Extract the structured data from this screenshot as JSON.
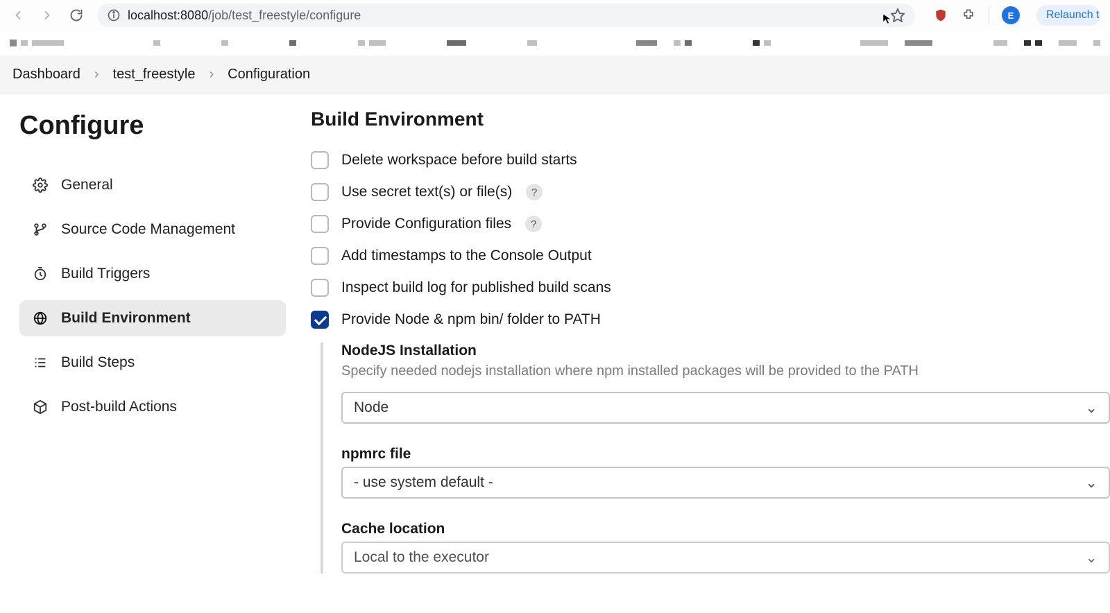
{
  "browser": {
    "url_host": "localhost:8080",
    "url_path": "/job/test_freestyle/configure",
    "avatar_initial": "E",
    "relaunch_label": "Relaunch t"
  },
  "breadcrumb": {
    "items": [
      "Dashboard",
      "test_freestyle",
      "Configuration"
    ]
  },
  "sidebar": {
    "title": "Configure",
    "items": [
      {
        "id": "general",
        "label": "General"
      },
      {
        "id": "scm",
        "label": "Source Code Management"
      },
      {
        "id": "triggers",
        "label": "Build Triggers"
      },
      {
        "id": "env",
        "label": "Build Environment",
        "active": true
      },
      {
        "id": "steps",
        "label": "Build Steps"
      },
      {
        "id": "post",
        "label": "Post-build Actions"
      }
    ]
  },
  "main": {
    "section_title": "Build Environment",
    "checks": [
      {
        "id": "delete_ws",
        "label": "Delete workspace before build starts",
        "checked": false,
        "help": false
      },
      {
        "id": "secret",
        "label": "Use secret text(s) or file(s)",
        "checked": false,
        "help": true
      },
      {
        "id": "configfiles",
        "label": "Provide Configuration files",
        "checked": false,
        "help": true
      },
      {
        "id": "timestamps",
        "label": "Add timestamps to the Console Output",
        "checked": false,
        "help": false
      },
      {
        "id": "buildscans",
        "label": "Inspect build log for published build scans",
        "checked": false,
        "help": false
      },
      {
        "id": "nodepath",
        "label": "Provide Node & npm bin/ folder to PATH",
        "checked": true,
        "help": false
      }
    ],
    "node_block": {
      "install_label": "NodeJS Installation",
      "install_desc": "Specify needed nodejs installation where npm installed packages will be provided to the PATH",
      "install_value": "Node",
      "npmrc_label": "npmrc file",
      "npmrc_value": "- use system default -",
      "cache_label": "Cache location",
      "cache_value": "Local to the executor"
    }
  }
}
